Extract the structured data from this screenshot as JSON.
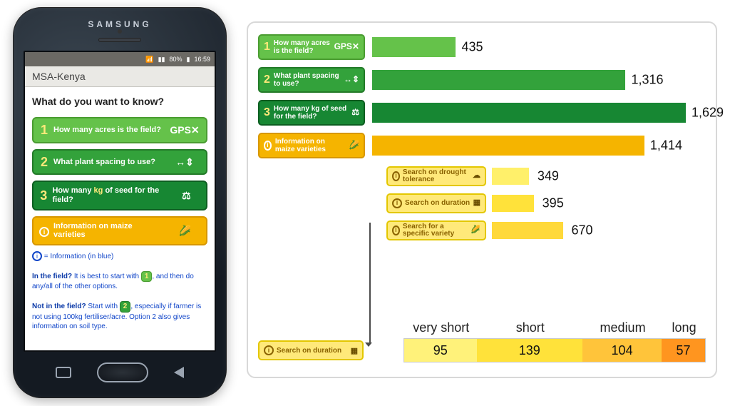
{
  "phone": {
    "brand": "SAMSUNG",
    "status": {
      "battery": "80%",
      "time": "16:59"
    },
    "app_title": "MSA-Kenya",
    "heading": "What do you want to know?",
    "options": [
      {
        "num": "1",
        "label": "How many acres is the field?",
        "icon": "gps-icon"
      },
      {
        "num": "2",
        "label": "What plant spacing to use?",
        "icon": "spacing-icon"
      },
      {
        "num": "3",
        "label_html": "How many <span style='color:#ffe97a'>kg</span> of seed for the field?",
        "label": "How many kg of seed for the field?",
        "icon": "scale-icon"
      },
      {
        "num": "ⓘ",
        "label": "Information on maize varieties",
        "icon": "maize-icon"
      }
    ],
    "notes": {
      "info_eq": "= Information (in blue)",
      "line1a": "In the field?",
      "line1b": "It is best to start with ",
      "line1c": ", and then do any/all of the other options.",
      "line2a": "Not in the field?",
      "line2b": "Start with ",
      "line2c": ", especially if farmer is not using 100kg fertiliser/acre. Option 2 also gives information on soil type."
    }
  },
  "chart_data": {
    "type": "bar",
    "title": "",
    "series": [
      {
        "name": "How many acres is the field?",
        "value": 435,
        "color": "#65c24a"
      },
      {
        "name": "What plant spacing to use?",
        "value": 1316,
        "color": "#33a23b"
      },
      {
        "name": "How many kg of seed for the field?",
        "value": 1629,
        "color": "#178733"
      },
      {
        "name": "Information on maize varieties",
        "value": 1414,
        "color": "#f5b400"
      }
    ],
    "sub_series": [
      {
        "name": "Search on drought tolerance",
        "value": 349,
        "color": "#fff06a"
      },
      {
        "name": "Search on duration",
        "value": 395,
        "color": "#ffe23a"
      },
      {
        "name": "Search for a specific variety",
        "value": 670,
        "color": "#ffd93a"
      }
    ],
    "duration_breakdown": {
      "label": "Search on duration",
      "categories": [
        "very short",
        "short",
        "medium",
        "long"
      ],
      "values": [
        95,
        139,
        104,
        57
      ],
      "colors": [
        "#fff27a",
        "#ffe23a",
        "#ffc43a",
        "#ff951f"
      ]
    },
    "xlim": [
      0,
      1629
    ]
  }
}
